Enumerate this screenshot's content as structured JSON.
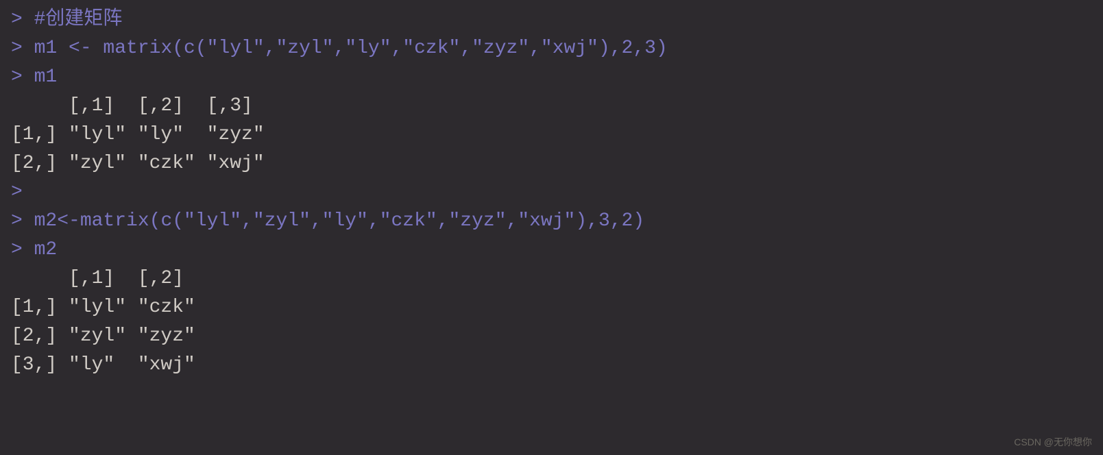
{
  "console": {
    "lines": [
      {
        "prompt": "> ",
        "text": "#创建矩阵",
        "type": "input"
      },
      {
        "prompt": "> ",
        "text": "m1 <- matrix(c(\"lyl\",\"zyl\",\"ly\",\"czk\",\"zyz\",\"xwj\"),2,3)",
        "type": "input"
      },
      {
        "prompt": "> ",
        "text": "m1",
        "type": "input"
      },
      {
        "prompt": "",
        "text": "     [,1]  [,2]  [,3] ",
        "type": "output"
      },
      {
        "prompt": "",
        "text": "[1,] \"lyl\" \"ly\"  \"zyz\"",
        "type": "output"
      },
      {
        "prompt": "",
        "text": "[2,] \"zyl\" \"czk\" \"xwj\"",
        "type": "output"
      },
      {
        "prompt": "> ",
        "text": "",
        "type": "input"
      },
      {
        "prompt": "> ",
        "text": "m2<-matrix(c(\"lyl\",\"zyl\",\"ly\",\"czk\",\"zyz\",\"xwj\"),3,2)",
        "type": "input"
      },
      {
        "prompt": "> ",
        "text": "m2",
        "type": "input"
      },
      {
        "prompt": "",
        "text": "     [,1]  [,2] ",
        "type": "output"
      },
      {
        "prompt": "",
        "text": "[1,] \"lyl\" \"czk\"",
        "type": "output"
      },
      {
        "prompt": "",
        "text": "[2,] \"zyl\" \"zyz\"",
        "type": "output"
      },
      {
        "prompt": "",
        "text": "[3,] \"ly\"  \"xwj\"",
        "type": "output"
      }
    ]
  },
  "watermark": "CSDN @无你想你"
}
